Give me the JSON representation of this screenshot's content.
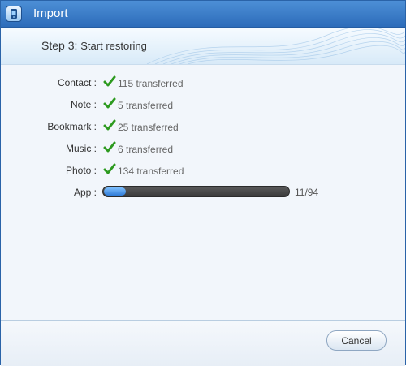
{
  "window": {
    "title": "Import"
  },
  "banner": {
    "step_label": "Step 3:",
    "step_title": "Start restoring"
  },
  "items": [
    {
      "label": "Contact :",
      "status": "115 transferred"
    },
    {
      "label": "Note :",
      "status": "5 transferred"
    },
    {
      "label": "Bookmark :",
      "status": "25 transferred"
    },
    {
      "label": "Music :",
      "status": "6 transferred"
    },
    {
      "label": "Photo :",
      "status": "134 transferred"
    }
  ],
  "progress": {
    "label": "App :",
    "count": "11/94",
    "fraction": 0.117
  },
  "footer": {
    "cancel_label": "Cancel"
  },
  "colors": {
    "accent": "#2d6cba",
    "check": "#2d9a1f",
    "progress": "#2f7ad6"
  }
}
